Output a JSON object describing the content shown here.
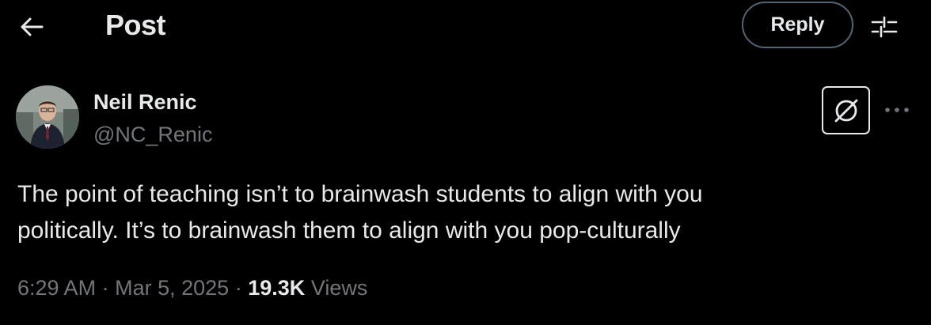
{
  "header": {
    "title": "Post",
    "reply_label": "Reply",
    "back_icon": "arrow-left-icon",
    "filter_icon": "sliders-icon"
  },
  "post": {
    "author": {
      "name": "Neil Renic",
      "handle": "@NC_Renic"
    },
    "text_line1": "The point of teaching isn’t to brainwash students to align with you",
    "text_line2": "politically. It’s to brainwash them to align with you pop-culturally",
    "time": "6:29 AM",
    "separator": "·",
    "date": "Mar 5, 2025",
    "views_count": "19.3K",
    "views_label": "Views",
    "grok_icon": "grok-icon",
    "more_icon": "more-dots-icon"
  },
  "colors": {
    "background": "#000000",
    "text_primary": "#e7e9ea",
    "text_secondary": "#71767b",
    "border": "#536471"
  }
}
